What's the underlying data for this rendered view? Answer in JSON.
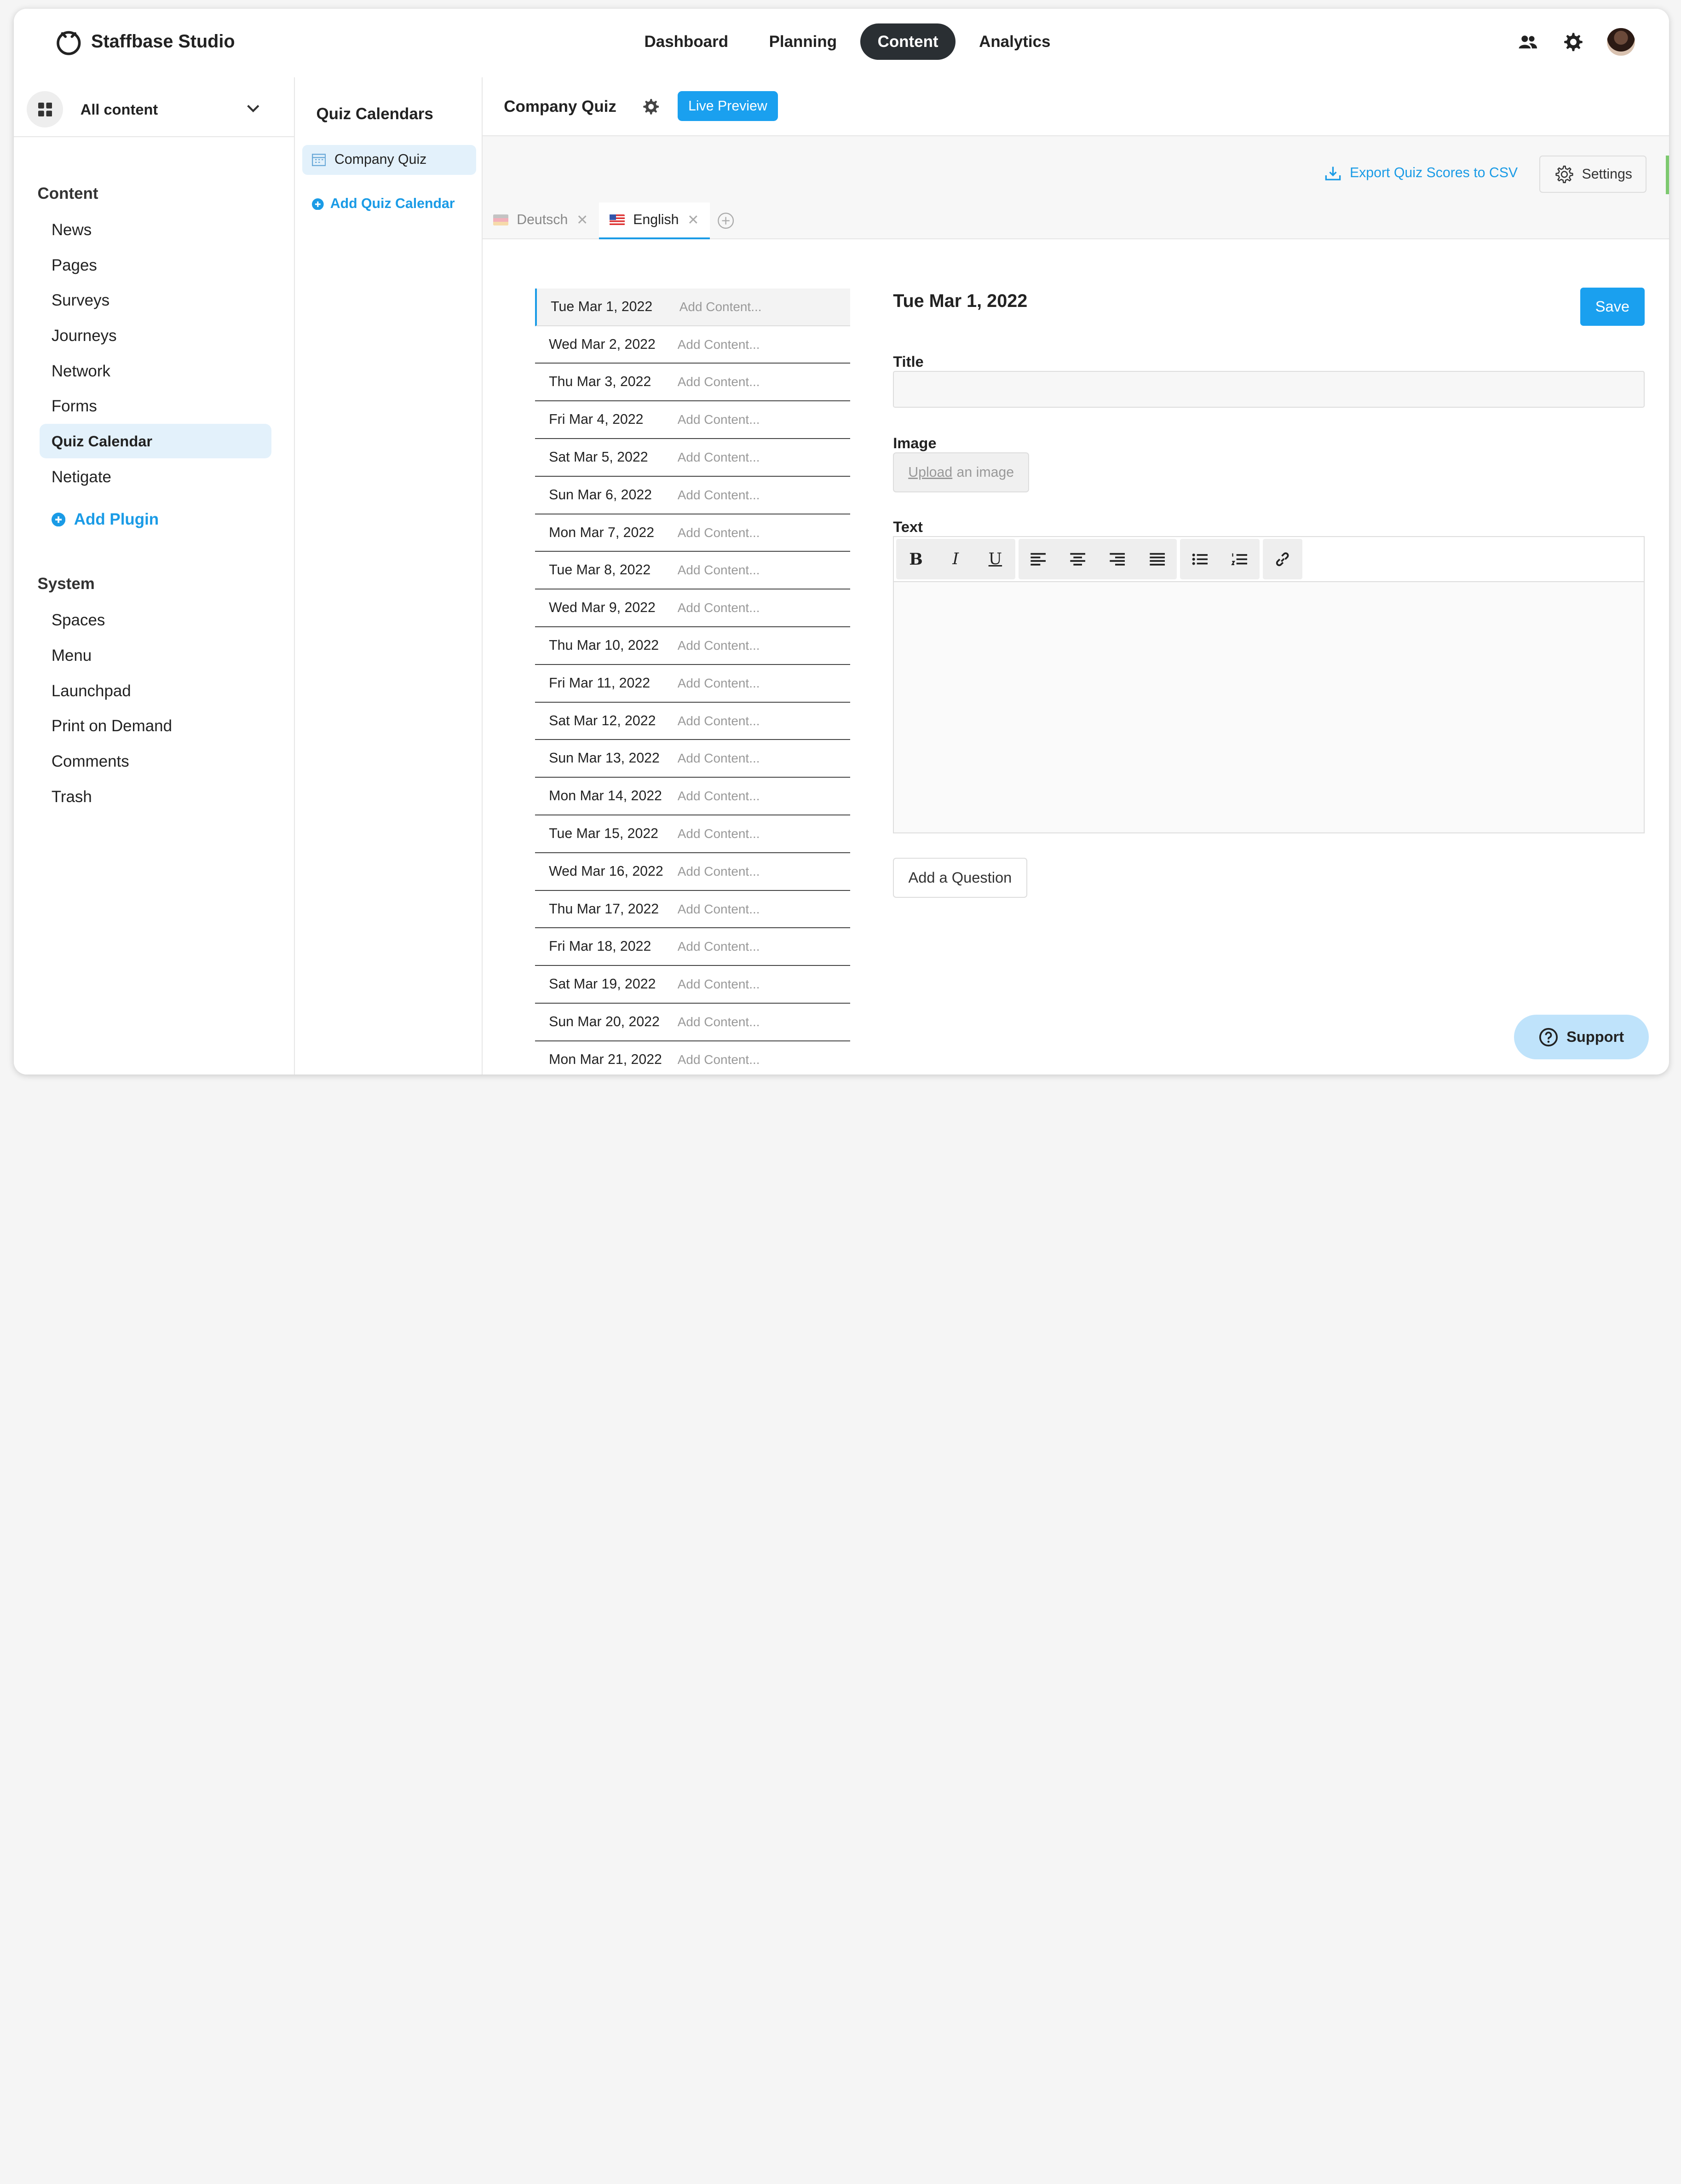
{
  "app": {
    "name": "Staffbase Studio"
  },
  "topnav": {
    "items": [
      {
        "label": "Dashboard"
      },
      {
        "label": "Planning"
      },
      {
        "label": "Content",
        "active": true
      },
      {
        "label": "Analytics"
      }
    ],
    "icons": [
      "people-icon",
      "gear-icon",
      "user-avatar"
    ]
  },
  "sidebar": {
    "scope_label": "All content",
    "content_title": "Content",
    "content_items": [
      "News",
      "Pages",
      "Surveys",
      "Journeys",
      "Network",
      "Forms",
      "Quiz Calendar",
      "Netigate"
    ],
    "active_item": "Quiz Calendar",
    "add_plugin": "Add Plugin",
    "system_title": "System",
    "system_items": [
      "Spaces",
      "Menu",
      "Launchpad",
      "Print on Demand",
      "Comments",
      "Trash"
    ]
  },
  "calendars": {
    "title": "Quiz Calendars",
    "items": [
      "Company Quiz"
    ],
    "add_label": "Add Quiz Calendar"
  },
  "main": {
    "title": "Company Quiz",
    "live_preview": "Live Preview",
    "export_label": "Export Quiz Scores to CSV",
    "settings_label": "Settings",
    "tabs": [
      {
        "label": "Deutsch",
        "active": false
      },
      {
        "label": "English",
        "active": true
      }
    ]
  },
  "dates": [
    "Tue Mar 1, 2022",
    "Wed Mar 2, 2022",
    "Thu Mar 3, 2022",
    "Fri Mar 4, 2022",
    "Sat Mar 5, 2022",
    "Sun Mar 6, 2022",
    "Mon Mar 7, 2022",
    "Tue Mar 8, 2022",
    "Wed Mar 9, 2022",
    "Thu Mar 10, 2022",
    "Fri Mar 11, 2022",
    "Sat Mar 12, 2022",
    "Sun Mar 13, 2022",
    "Mon Mar 14, 2022",
    "Tue Mar 15, 2022",
    "Wed Mar 16, 2022",
    "Thu Mar 17, 2022",
    "Fri Mar 18, 2022",
    "Sat Mar 19, 2022",
    "Sun Mar 20, 2022",
    "Mon Mar 21, 2022"
  ],
  "add_content_label": "Add Content...",
  "editor": {
    "date": "Tue Mar 1, 2022",
    "save": "Save",
    "title_label": "Title",
    "title_value": "",
    "image_label": "Image",
    "upload_link": "Upload",
    "upload_rest": "an image",
    "text_label": "Text",
    "add_question": "Add a Question"
  },
  "support": {
    "label": "Support"
  },
  "colors": {
    "accent": "#1aa0ef",
    "active_bg": "#e3f1fb",
    "nav_active": "#2a2f33"
  }
}
